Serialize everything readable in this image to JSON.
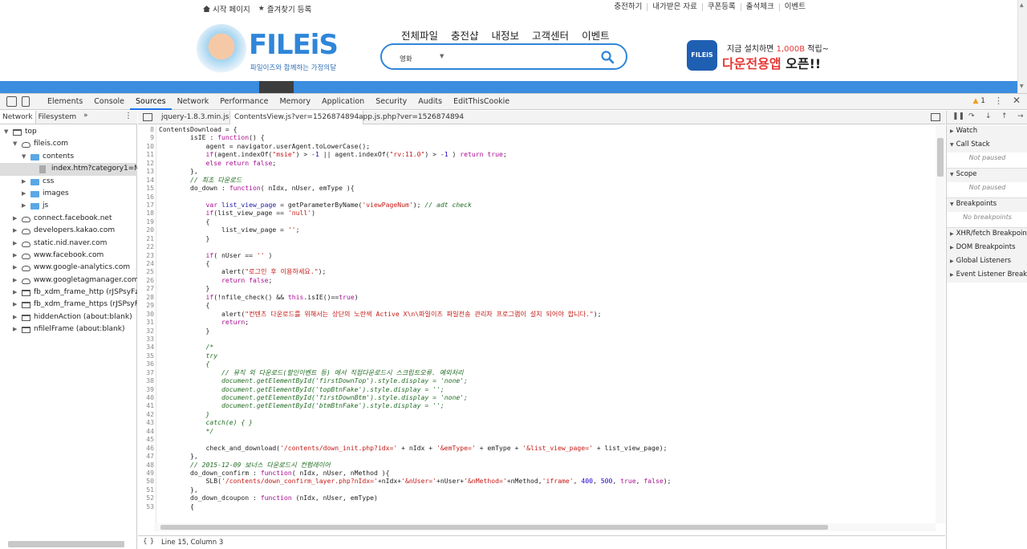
{
  "site": {
    "top_links_left": [
      "시작 페이지",
      "즐겨찾기 등록"
    ],
    "top_links_right": [
      "충전하기",
      "내가받은 자료",
      "쿠폰등록",
      "출석체크",
      "이벤트"
    ],
    "logo_text": "FILEiS",
    "logo_tagline": "파일이즈와 함께하는 가정의달",
    "gnb": [
      "전체파일",
      "충전샵",
      "내정보",
      "고객센터",
      "이벤트"
    ],
    "search": {
      "category": "영화",
      "value": ""
    },
    "banner": {
      "line1_pre": "지금 설치하면 ",
      "line1_amount": "1,000B",
      "line1_post": " 적립~",
      "line2_red": "다운전용앱 ",
      "line2_black": "오픈!!",
      "app_label": "FILEiS"
    }
  },
  "devtools": {
    "tabs": [
      "Elements",
      "Console",
      "Sources",
      "Network",
      "Performance",
      "Memory",
      "Application",
      "Security",
      "Audits",
      "EditThisCookie"
    ],
    "active_tab": "Sources",
    "warnings": "1",
    "navigator_tabs": [
      "Network",
      "Filesystem"
    ],
    "tree": [
      {
        "label": "top",
        "level": 0,
        "icon": "frame",
        "arrow": "▼"
      },
      {
        "label": "fileis.com",
        "level": 1,
        "icon": "cloud",
        "arrow": "▼"
      },
      {
        "label": "contents",
        "level": 2,
        "icon": "folder",
        "arrow": "▼"
      },
      {
        "label": "index.htm?category1=MVO",
        "level": 3,
        "icon": "file",
        "arrow": "",
        "selected": true
      },
      {
        "label": "css",
        "level": 2,
        "icon": "folder",
        "arrow": "▶"
      },
      {
        "label": "images",
        "level": 2,
        "icon": "folder",
        "arrow": "▶"
      },
      {
        "label": "js",
        "level": 2,
        "icon": "folder",
        "arrow": "▶"
      },
      {
        "label": "connect.facebook.net",
        "level": 1,
        "icon": "cloud",
        "arrow": "▶"
      },
      {
        "label": "developers.kakao.com",
        "level": 1,
        "icon": "cloud",
        "arrow": "▶"
      },
      {
        "label": "static.nid.naver.com",
        "level": 1,
        "icon": "cloud",
        "arrow": "▶"
      },
      {
        "label": "www.facebook.com",
        "level": 1,
        "icon": "cloud",
        "arrow": "▶"
      },
      {
        "label": "www.google-analytics.com",
        "level": 1,
        "icon": "cloud",
        "arrow": "▶"
      },
      {
        "label": "www.googletagmanager.com",
        "level": 1,
        "icon": "cloud",
        "arrow": "▶"
      },
      {
        "label": "fb_xdm_frame_http (rJSPsyFz8kQ",
        "level": 1,
        "icon": "frame",
        "arrow": "▶"
      },
      {
        "label": "fb_xdm_frame_https (rJSPsyFz8kC",
        "level": 1,
        "icon": "frame",
        "arrow": "▶"
      },
      {
        "label": "hiddenAction (about:blank)",
        "level": 1,
        "icon": "frame",
        "arrow": "▶"
      },
      {
        "label": "nfilelFrame (about:blank)",
        "level": 1,
        "icon": "frame",
        "arrow": "▶"
      }
    ],
    "editor_tabs": [
      "jquery-1.8.3.min.js",
      "ContentsView.js?ver=1526874894",
      "app.js.php?ver=1526874894"
    ],
    "active_editor_tab": "ContentsView.js?ver=1526874894",
    "status": "Line 15, Column 3",
    "sidebar": {
      "sections": [
        {
          "title": "Watch",
          "empty": ""
        },
        {
          "title": "Call Stack",
          "empty": "Not paused"
        },
        {
          "title": "Scope",
          "empty": "Not paused"
        },
        {
          "title": "Breakpoints",
          "empty": "No breakpoints"
        },
        {
          "title": "XHR/fetch Breakpoints",
          "empty": ""
        },
        {
          "title": "DOM Breakpoints",
          "empty": ""
        },
        {
          "title": "Global Listeners",
          "empty": ""
        },
        {
          "title": "Event Listener Breakpoints",
          "empty": ""
        }
      ]
    },
    "code_lines": [
      {
        "no": "8",
        "html": "ContentsDownload = {"
      },
      {
        "no": "9",
        "html": "        isIE : <span class=k>function</span>() {"
      },
      {
        "no": "10",
        "html": "            agent = navigator.userAgent.toLowerCase();"
      },
      {
        "no": "11",
        "html": "            <span class=k>if</span>(agent.indexOf(<span class=s>\"msie\"</span>) &gt; -<span class=n>1</span> || agent.indexOf(<span class=s>\"rv:11.0\"</span>) &gt; -<span class=n>1</span> ) <span class=k>return true</span>;"
      },
      {
        "no": "12",
        "html": "            <span class=k>else return false</span>;"
      },
      {
        "no": "13",
        "html": "        },"
      },
      {
        "no": "14",
        "html": "        <span class=c>// 최초 다운로드</span>"
      },
      {
        "no": "15",
        "html": "        do_down : <span class=k>function</span>( nIdx, nUser, emType ){"
      },
      {
        "no": "16",
        "html": ""
      },
      {
        "no": "17",
        "html": "            <span class=k>var</span> <span class=v>list_view_page</span> = getParameterByName(<span class=s>'viewPageNum'</span>); <span class=c>// adt check</span>"
      },
      {
        "no": "18",
        "html": "            <span class=k>if</span>(list_view_page == <span class=s>'null'</span>)"
      },
      {
        "no": "19",
        "html": "            {"
      },
      {
        "no": "20",
        "html": "                list_view_page = <span class=s>''</span>;"
      },
      {
        "no": "21",
        "html": "            }"
      },
      {
        "no": "22",
        "html": ""
      },
      {
        "no": "23",
        "html": "            <span class=k>if</span>( nUser == <span class=s>''</span> )"
      },
      {
        "no": "24",
        "html": "            {"
      },
      {
        "no": "25",
        "html": "                alert(<span class=s>\"로그인 후 이용하세요.\"</span>);"
      },
      {
        "no": "26",
        "html": "                <span class=k>return false</span>;"
      },
      {
        "no": "27",
        "html": "            }"
      },
      {
        "no": "28",
        "html": "            <span class=k>if</span>(!nfile_check() &amp;&amp; <span class=k>this</span>.isIE()==<span class=k>true</span>)"
      },
      {
        "no": "29",
        "html": "            {"
      },
      {
        "no": "30",
        "html": "                alert(<span class=s>\"컨텐츠 다운로드를 위해서는 상단의 노란색 Active X\\n\\파일이즈 파일전송 관리자 프로그램이 설치 되어야 합니다.\"</span>);"
      },
      {
        "no": "31",
        "html": "                <span class=k>return</span>;"
      },
      {
        "no": "32",
        "html": "            }"
      },
      {
        "no": "33",
        "html": ""
      },
      {
        "no": "34",
        "html": "            <span class=c>/*</span>"
      },
      {
        "no": "35",
        "html": "<span class=c>            try</span>"
      },
      {
        "no": "36",
        "html": "<span class=c>            {</span>"
      },
      {
        "no": "37",
        "html": "<span class=c>                // 뮤직 외 다운로드(할인이벤트 등) 에서 직접다운로드시 스크립트오류. 예외처리</span>"
      },
      {
        "no": "38",
        "html": "<span class=c>                document.getElementById('firstDownTop').style.display = 'none';</span>"
      },
      {
        "no": "39",
        "html": "<span class=c>                document.getElementById('topBtnFake').style.display = '';</span>"
      },
      {
        "no": "40",
        "html": "<span class=c>                document.getElementById('firstDownBtm').style.display = 'none';</span>"
      },
      {
        "no": "41",
        "html": "<span class=c>                document.getElementById('btmBtnFake').style.display = '';</span>"
      },
      {
        "no": "42",
        "html": "<span class=c>            }</span>"
      },
      {
        "no": "43",
        "html": "<span class=c>            catch(e) { }</span>"
      },
      {
        "no": "44",
        "html": "<span class=c>            */</span>"
      },
      {
        "no": "45",
        "html": ""
      },
      {
        "no": "46",
        "html": "            check_and_download(<span class=s>'/contents/down_init.php?idx='</span> + nIdx + <span class=s>'&amp;emType='</span> + emType + <span class=s>'&amp;list_view_page='</span> + list_view_page);"
      },
      {
        "no": "47",
        "html": "        },"
      },
      {
        "no": "48",
        "html": "        <span class=c>// 2015-12-09 보너스 다운로드시 컨펌레이어</span>"
      },
      {
        "no": "49",
        "html": "        do_down_confirm : <span class=k>function</span>( nIdx, nUser, nMethod ){"
      },
      {
        "no": "50",
        "html": "            SLB(<span class=s>'/contents/down_confirm_layer.php?nIdx='</span>+nIdx+<span class=s>'&amp;nUser='</span>+nUser+<span class=s>'&amp;nMethod='</span>+nMethod,<span class=s>'iframe'</span>, <span class=n>400</span>, <span class=n>500</span>, <span class=k>true</span>, <span class=k>false</span>);"
      },
      {
        "no": "51",
        "html": "        },"
      },
      {
        "no": "52",
        "html": "        do_down_dcoupon : <span class=k>function</span> (nIdx, nUser, emType)"
      },
      {
        "no": "53",
        "html": "        {"
      }
    ]
  }
}
